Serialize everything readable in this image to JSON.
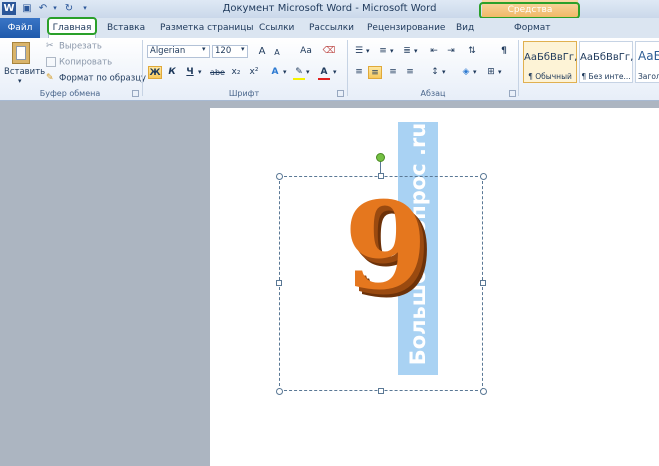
{
  "window": {
    "title": "Документ Microsoft Word  -  Microsoft Word",
    "app_icon": "W",
    "context_tab_header": "Средства рисования"
  },
  "tabs": {
    "file": "Файл",
    "home": "Главная",
    "insert": "Вставка",
    "layout": "Разметка страницы",
    "references": "Ссылки",
    "mailings": "Рассылки",
    "review": "Рецензирование",
    "view": "Вид",
    "format": "Формат"
  },
  "clipboard": {
    "paste": "Вставить",
    "cut": "Вырезать",
    "copy": "Копировать",
    "format_painter": "Формат по образцу",
    "group_label": "Буфер обмена"
  },
  "font": {
    "family": "Algerian",
    "size": "120",
    "bold": "Ж",
    "italic": "К",
    "underline": "Ч",
    "strike": "abe",
    "subscript": "x₂",
    "superscript": "x²",
    "grow": "A",
    "shrink": "A",
    "case": "Aa",
    "group_label": "Шрифт"
  },
  "paragraph": {
    "group_label": "Абзац"
  },
  "styles": {
    "items": [
      {
        "sample": "АаБбВвГг,",
        "name": "¶ Обычный"
      },
      {
        "sample": "АаБбВвГг,",
        "name": "¶ Без инте..."
      },
      {
        "sample": "АаБ",
        "name": "Загол"
      }
    ]
  },
  "document": {
    "watermark_text": "Большой вопрос .ru",
    "wordart_char": "9"
  },
  "colors": {
    "accent": "#2b579a",
    "file_tab": "#1f5aab",
    "context_tab": "#f0b35c",
    "highlight_frame": "#2aa02a",
    "wordart": "#e5771e",
    "watermark_bg": "#a9d2f3"
  }
}
